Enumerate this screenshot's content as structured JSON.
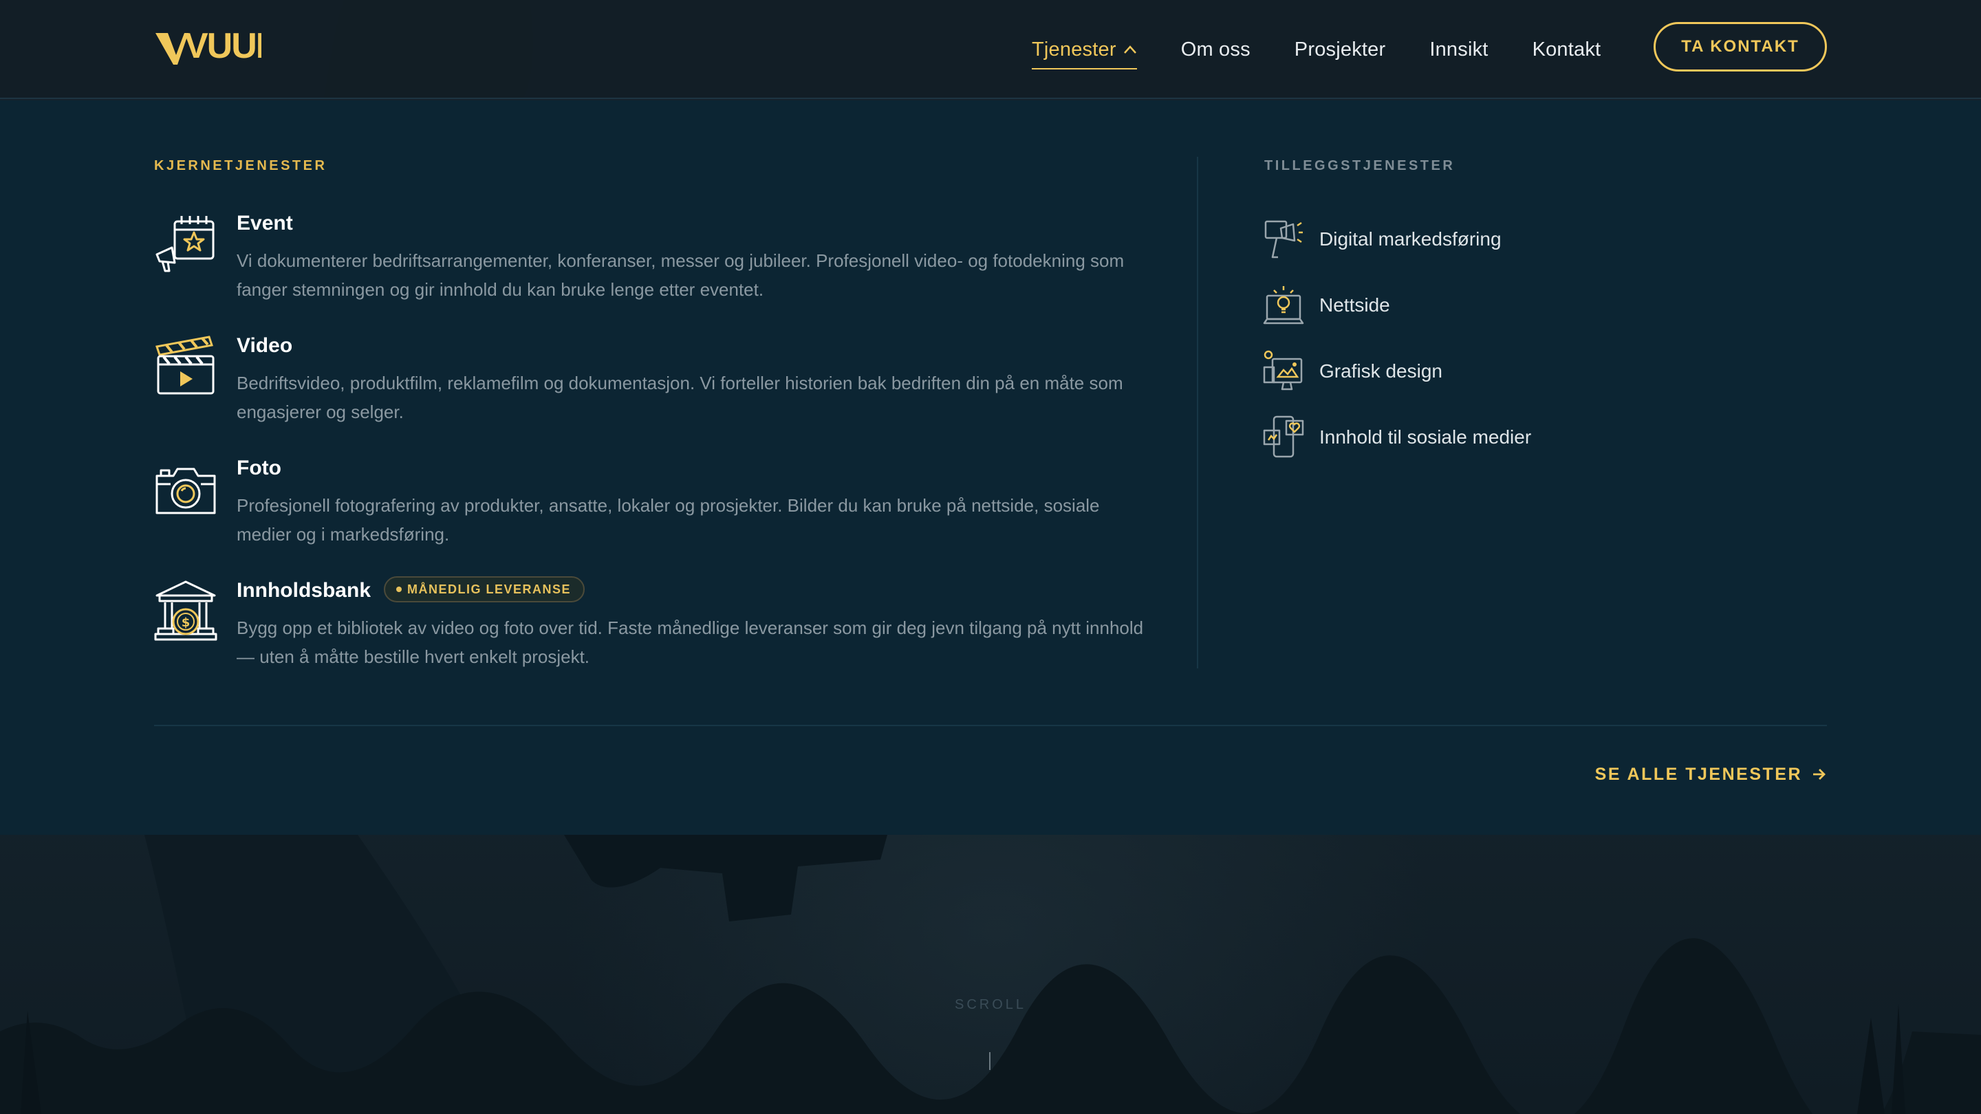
{
  "brand": {
    "logo_text": "VUUR",
    "accent": "#f0c75a"
  },
  "nav": {
    "items": [
      {
        "label": "Tjenester",
        "active": true,
        "icon": "chevron-up-icon"
      },
      {
        "label": "Om oss"
      },
      {
        "label": "Prosjekter"
      },
      {
        "label": "Innsikt"
      },
      {
        "label": "Kontakt"
      }
    ],
    "cta": "TA KONTAKT"
  },
  "menu": {
    "core_label": "KJERNETJENESTER",
    "addon_label": "TILLEGGSTJENESTER",
    "core": [
      {
        "title": "Event",
        "icon": "event-calendar-megaphone-icon",
        "desc": "Vi dokumenterer bedriftsarrangementer, konferanser, messer og jubileer. Profesjonell video- og fotodekning som fanger stemningen og gir innhold du kan bruke lenge etter eventet."
      },
      {
        "title": "Video",
        "icon": "clapperboard-icon",
        "desc": "Bedriftsvideo, produktfilm, reklamefilm og dokumentasjon. Vi forteller historien bak bedriften din på en måte som engasjerer og selger."
      },
      {
        "title": "Foto",
        "icon": "camera-icon",
        "desc": "Profesjonell fotografering av produkter, ansatte, lokaler og prosjekter. Bilder du kan bruke på nettside, sosiale medier og i markedsføring."
      },
      {
        "title": "Innholdsbank",
        "icon": "bank-coin-icon",
        "badge": "MÅNEDLIG LEVERANSE",
        "desc": "Bygg opp et bibliotek av video og foto over tid. Faste månedlige leveranser som gir deg jevn tilgang på nytt innhold — uten å måtte bestille hvert enkelt prosjekt."
      }
    ],
    "addons": [
      {
        "label": "Digital markedsføring",
        "icon": "megaphone-screen-icon"
      },
      {
        "label": "Nettside",
        "icon": "laptop-lightbulb-icon"
      },
      {
        "label": "Grafisk design",
        "icon": "design-monitor-icon"
      },
      {
        "label": "Innhold til sosiale medier",
        "icon": "social-phone-icon"
      }
    ],
    "see_all": "SE ALLE TJENESTER",
    "see_all_icon": "arrow-right-icon"
  },
  "scroll": {
    "label": "SCROLL"
  }
}
